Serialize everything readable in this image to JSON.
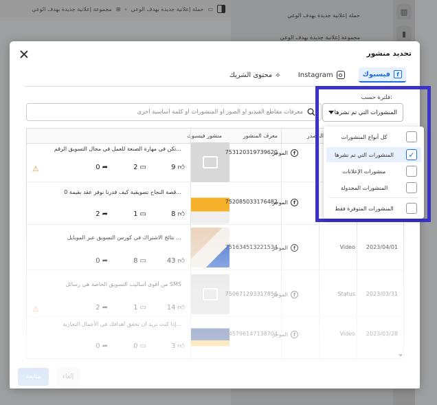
{
  "background": {
    "breadcrumb": [
      "حملة إعلانية جديدة بهدف الوعي",
      "مجموعة إعلانية جديدة بهدف الوعي"
    ],
    "right_panel_rows": [
      "حملة إعلانية جديدة بهدف الوعي",
      "مجموعة إعلانية جديدة بهدف الوعي"
    ],
    "rail_icons": [
      "panel-icon",
      "chart-icon",
      "pencil-icon",
      "clock-icon"
    ]
  },
  "modal": {
    "title": "تحديد منشور",
    "tabs": [
      {
        "label": "فيسبوك",
        "icon": "facebook-icon",
        "active": true
      },
      {
        "label": "Instagram",
        "icon": "instagram-icon",
        "active": false
      },
      {
        "label": "محتوى الشريك",
        "icon": "handshake-icon",
        "active": false
      }
    ],
    "filter_label": "فلترة حسب:",
    "filter_value": "المنشورات التي تم نشرها",
    "search_placeholder": "معرفات مقاطع الفيديو أو الصور أو المنشورات أو كلمة أساسية أخرى",
    "columns": [
      "منشور فيسبوك",
      "معرف المنشور",
      "المصدر",
      "",
      ""
    ],
    "rows": [
      {
        "message": "تكن في مهارة الصنعة للعمل في مجال التسويق الرقم...",
        "likes": "9",
        "comments": "2",
        "shares": "0",
        "warning": true,
        "post_id": "753120319739620",
        "source": "الموجز",
        "type": "",
        "date": "",
        "thumb": "gray"
      },
      {
        "message": "قصة النجاح تسويقية كيف قدرنا نوفر عقد بقيمة 0...",
        "likes": "8",
        "comments": "1",
        "shares": "2",
        "warning": false,
        "post_id": "752085033176482",
        "source": "الموجز",
        "type": "",
        "date": "",
        "thumb": "yellow"
      },
      {
        "message": "نتائج الاشتراك في كورس التسويق عبر الموبايل ...",
        "likes": "43",
        "comments": "8",
        "shares": "0",
        "warning": false,
        "post_id": "751634513221534",
        "source": "الموجز",
        "type": "Video",
        "date": "2023/04/01",
        "thumb": "photo"
      },
      {
        "message": "من أقوى أساليب التسويق الخاصة هي رسائل SMS",
        "likes": "14",
        "comments": "1",
        "shares": "2",
        "warning": true,
        "post_id": "750671293317856",
        "source": "الموجز",
        "type": "Status",
        "date": "2023/03/31",
        "thumb": "gray"
      },
      {
        "message": "إذا كنت تريد أن تحقق أهدافك في الأعمال التجارية...",
        "likes": "3",
        "comments": "0",
        "shares": "0",
        "warning": false,
        "post_id": "745796147138704",
        "source": "الموجز",
        "type": "Video",
        "date": "2023/03/28",
        "thumb": "doc"
      }
    ],
    "buttons": {
      "next": "متابعة",
      "cancel": "إلغاء"
    }
  },
  "dropdown": {
    "options": [
      {
        "label": "كل أنواع المنشورات",
        "checked": false
      },
      {
        "label": "المنشورات التي تم نشرها",
        "checked": true
      },
      {
        "label": "منشورات الإعلانات",
        "checked": false
      },
      {
        "label": "المنشورات المجدولة",
        "checked": false
      },
      {
        "label": "المنشورات المتوفرة فقط",
        "checked": false
      }
    ]
  },
  "colors": {
    "accent": "#1b6fe0",
    "highlight_border": "#3a33c7",
    "warning": "#e0912c"
  }
}
